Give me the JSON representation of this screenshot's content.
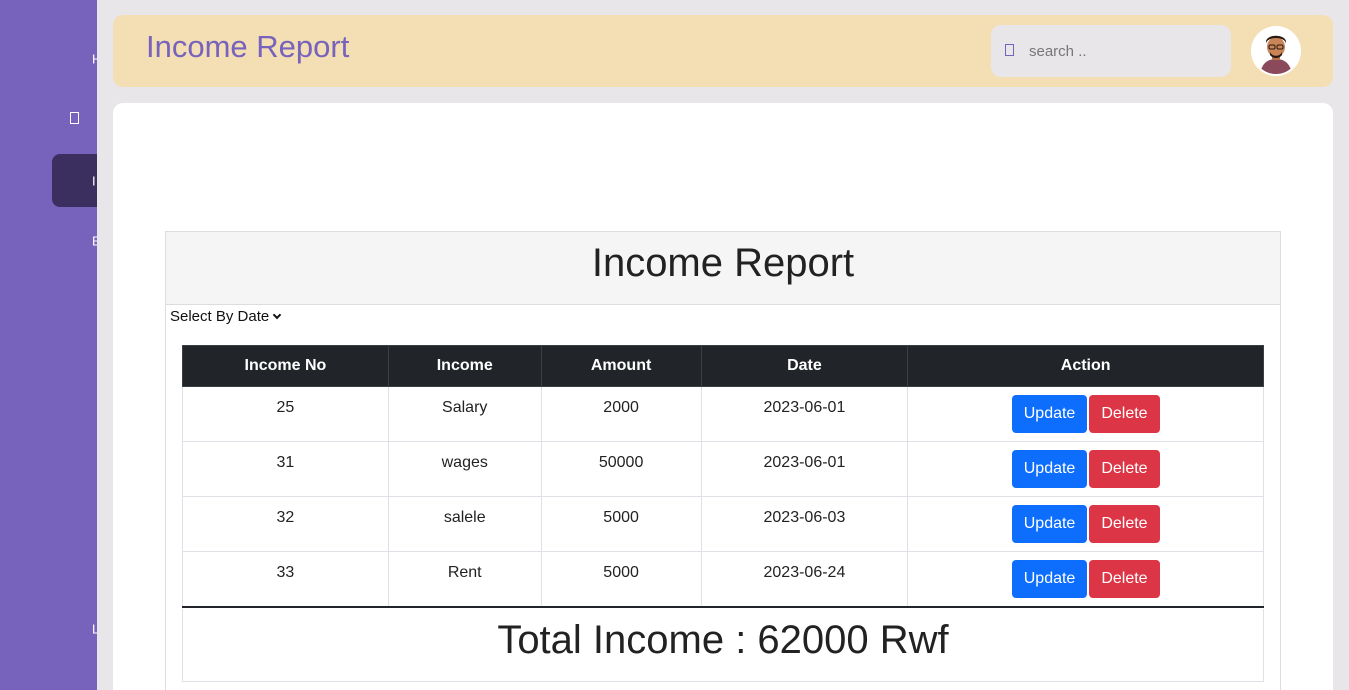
{
  "sidebar": {
    "items": [
      {
        "label": "H"
      },
      {
        "label": ""
      },
      {
        "label": "I"
      },
      {
        "label": "E"
      },
      {
        "label": "L"
      }
    ]
  },
  "header": {
    "title": "Income Report",
    "search_placeholder": "search .."
  },
  "report": {
    "title": "Income Report",
    "date_filter": "Select By Date",
    "columns": [
      "Income No",
      "Income",
      "Amount",
      "Date",
      "Action"
    ],
    "rows": [
      {
        "no": "25",
        "income": "Salary",
        "amount": "2000",
        "date": "2023-06-01"
      },
      {
        "no": "31",
        "income": "wages",
        "amount": "50000",
        "date": "2023-06-01"
      },
      {
        "no": "32",
        "income": "salele",
        "amount": "5000",
        "date": "2023-06-03"
      },
      {
        "no": "33",
        "income": "Rent",
        "amount": "5000",
        "date": "2023-06-24"
      }
    ],
    "update_label": "Update",
    "delete_label": "Delete",
    "total": "Total Income : 62000 Rwf"
  },
  "colors": {
    "sidebar": "#7763bb",
    "header": "#f4deb3",
    "update": "#0d6efd",
    "delete": "#dc3545"
  }
}
